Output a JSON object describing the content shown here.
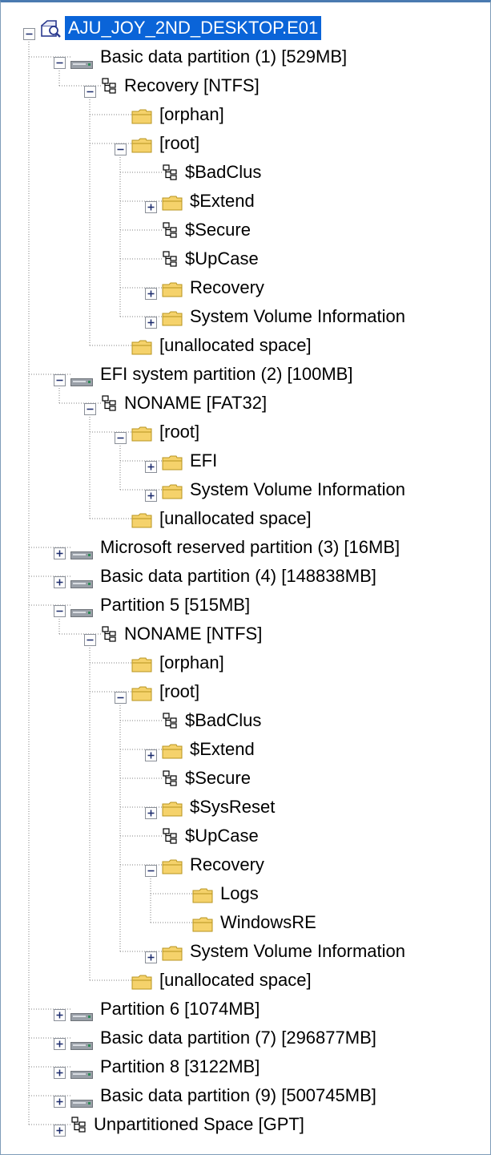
{
  "tree": {
    "nodes": [
      {
        "label": "AJU_JOY_2ND_DESKTOP.E01",
        "level": 0,
        "icon": "evidence-icon",
        "expander": "minus",
        "selected": true
      },
      {
        "label": "Basic data partition (1) [529MB]",
        "level": 1,
        "icon": "partition-icon",
        "expander": "minus"
      },
      {
        "label": "Recovery [NTFS]",
        "level": 2,
        "icon": "filesystem-icon",
        "expander": "minus"
      },
      {
        "label": "[orphan]",
        "level": 3,
        "icon": "folder-icon",
        "expander": "none"
      },
      {
        "label": "[root]",
        "level": 3,
        "icon": "folder-icon",
        "expander": "minus"
      },
      {
        "label": "$BadClus",
        "level": 4,
        "icon": "filesystem-icon",
        "expander": "none"
      },
      {
        "label": "$Extend",
        "level": 4,
        "icon": "folder-icon",
        "expander": "plus"
      },
      {
        "label": "$Secure",
        "level": 4,
        "icon": "filesystem-icon",
        "expander": "none"
      },
      {
        "label": "$UpCase",
        "level": 4,
        "icon": "filesystem-icon",
        "expander": "none"
      },
      {
        "label": "Recovery",
        "level": 4,
        "icon": "folder-icon",
        "expander": "plus"
      },
      {
        "label": "System Volume Information",
        "level": 4,
        "icon": "folder-icon",
        "expander": "plus"
      },
      {
        "label": "[unallocated space]",
        "level": 3,
        "icon": "folder-icon",
        "expander": "none"
      },
      {
        "label": "EFI system partition (2) [100MB]",
        "level": 1,
        "icon": "partition-icon",
        "expander": "minus"
      },
      {
        "label": "NONAME [FAT32]",
        "level": 2,
        "icon": "filesystem-icon",
        "expander": "minus"
      },
      {
        "label": "[root]",
        "level": 3,
        "icon": "folder-icon",
        "expander": "minus"
      },
      {
        "label": "EFI",
        "level": 4,
        "icon": "folder-icon",
        "expander": "plus"
      },
      {
        "label": "System Volume Information",
        "level": 4,
        "icon": "folder-icon",
        "expander": "plus"
      },
      {
        "label": "[unallocated space]",
        "level": 3,
        "icon": "folder-icon",
        "expander": "none"
      },
      {
        "label": "Microsoft reserved partition (3) [16MB]",
        "level": 1,
        "icon": "partition-icon",
        "expander": "plus"
      },
      {
        "label": "Basic data partition (4) [148838MB]",
        "level": 1,
        "icon": "partition-icon",
        "expander": "plus"
      },
      {
        "label": "Partition 5 [515MB]",
        "level": 1,
        "icon": "partition-icon",
        "expander": "minus"
      },
      {
        "label": "NONAME [NTFS]",
        "level": 2,
        "icon": "filesystem-icon",
        "expander": "minus"
      },
      {
        "label": "[orphan]",
        "level": 3,
        "icon": "folder-icon",
        "expander": "none"
      },
      {
        "label": "[root]",
        "level": 3,
        "icon": "folder-icon",
        "expander": "minus"
      },
      {
        "label": "$BadClus",
        "level": 4,
        "icon": "filesystem-icon",
        "expander": "none"
      },
      {
        "label": "$Extend",
        "level": 4,
        "icon": "folder-icon",
        "expander": "plus"
      },
      {
        "label": "$Secure",
        "level": 4,
        "icon": "filesystem-icon",
        "expander": "none"
      },
      {
        "label": "$SysReset",
        "level": 4,
        "icon": "folder-icon",
        "expander": "plus"
      },
      {
        "label": "$UpCase",
        "level": 4,
        "icon": "filesystem-icon",
        "expander": "none"
      },
      {
        "label": "Recovery",
        "level": 4,
        "icon": "folder-icon",
        "expander": "minus"
      },
      {
        "label": "Logs",
        "level": 5,
        "icon": "folder-icon",
        "expander": "none"
      },
      {
        "label": "WindowsRE",
        "level": 5,
        "icon": "folder-icon",
        "expander": "none"
      },
      {
        "label": "System Volume Information",
        "level": 4,
        "icon": "folder-icon",
        "expander": "plus"
      },
      {
        "label": "[unallocated space]",
        "level": 3,
        "icon": "folder-icon",
        "expander": "none"
      },
      {
        "label": "Partition 6 [1074MB]",
        "level": 1,
        "icon": "partition-icon",
        "expander": "plus"
      },
      {
        "label": "Basic data partition (7) [296877MB]",
        "level": 1,
        "icon": "partition-icon",
        "expander": "plus"
      },
      {
        "label": "Partition 8 [3122MB]",
        "level": 1,
        "icon": "partition-icon",
        "expander": "plus"
      },
      {
        "label": "Basic data partition (9) [500745MB]",
        "level": 1,
        "icon": "partition-icon",
        "expander": "plus"
      },
      {
        "label": "Unpartitioned Space [GPT]",
        "level": 1,
        "icon": "filesystem-icon",
        "expander": "plus"
      }
    ]
  },
  "colors": {
    "selection": "#0a64d8",
    "folder": "#f5d26b",
    "folder_edge": "#b8941f",
    "tree_line": "#808080",
    "partition": "#9aa0a8"
  }
}
